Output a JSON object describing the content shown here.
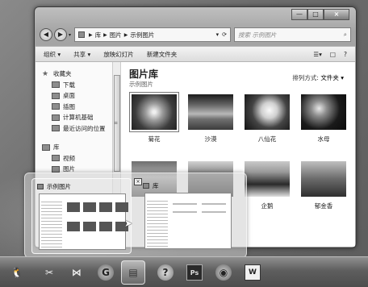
{
  "window": {
    "caption_buttons": {
      "minimize": "—",
      "maximize": "□",
      "close": "×"
    }
  },
  "address_bar": {
    "back_icon": "back-arrow-icon",
    "forward_icon": "forward-arrow-icon",
    "segments": [
      "库",
      "图片",
      "示例图片"
    ],
    "refresh_icon": "refresh-icon"
  },
  "search": {
    "placeholder": "搜索 示例图片",
    "icon": "magnifier-icon"
  },
  "toolbar": {
    "organize": "组织 ▾",
    "share": "共享 ▾",
    "slideshow": "放映幻灯片",
    "new_folder": "新建文件夹"
  },
  "sidebar": {
    "favorites": "收藏夹",
    "favorites_items": [
      "下载",
      "桌面",
      "插图",
      "计算机基础",
      "最近访问的位置"
    ],
    "libraries": "库",
    "library_items": [
      "视频",
      "图片"
    ]
  },
  "library": {
    "title": "图片库",
    "subtitle": "示例图片",
    "arrange_label": "排列方式:",
    "arrange_value": "文件夹 ▾"
  },
  "thumbnails": [
    {
      "label": "菊花",
      "selected": true
    },
    {
      "label": "沙漠",
      "selected": false
    },
    {
      "label": "八仙花",
      "selected": false
    },
    {
      "label": "水母",
      "selected": false
    },
    {
      "label": "",
      "selected": false
    },
    {
      "label": "",
      "selected": false
    },
    {
      "label": "企鹅",
      "selected": false
    },
    {
      "label": "郁金香",
      "selected": false
    }
  ],
  "peek": {
    "cards": [
      {
        "title": "示例图片",
        "icon": "folder-icon",
        "hovered": true
      },
      {
        "title": "库",
        "icon": "folder-icon",
        "hovered": false
      }
    ]
  },
  "taskbar": {
    "items": [
      {
        "name": "qq-icon",
        "glyph": "🐧",
        "active": false
      },
      {
        "name": "tool-icon",
        "glyph": "✂",
        "active": false
      },
      {
        "name": "visual-studio-icon",
        "glyph": "⋈",
        "active": false
      },
      {
        "name": "app-icon",
        "glyph": "G",
        "active": false
      },
      {
        "name": "explorer-icon",
        "glyph": "▤",
        "active": true
      },
      {
        "name": "help-icon",
        "glyph": "?",
        "active": false
      },
      {
        "name": "photoshop-icon",
        "glyph": "Ps",
        "active": false
      },
      {
        "name": "firefox-icon",
        "glyph": "◉",
        "active": false
      },
      {
        "name": "word-icon",
        "glyph": "W",
        "active": false
      }
    ]
  }
}
